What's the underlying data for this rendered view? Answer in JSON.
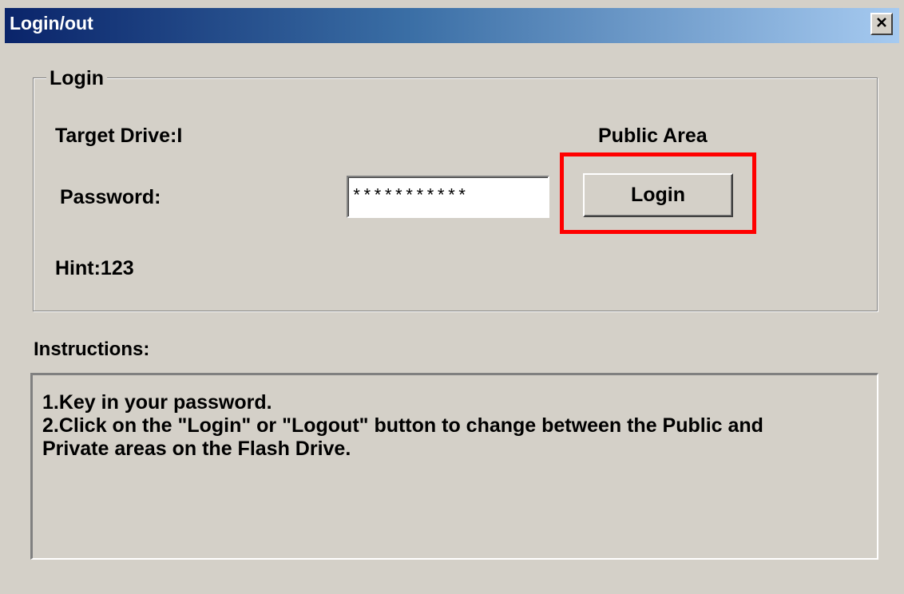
{
  "window": {
    "title": "Login/out",
    "close_icon": "close-icon"
  },
  "login_group": {
    "legend": "Login",
    "target_drive": "Target Drive:I",
    "area": "Public Area",
    "password_label": "Password:",
    "password_value": "***********",
    "login_button": "Login",
    "hint": "Hint:123"
  },
  "instructions": {
    "heading": "Instructions:",
    "lines": [
      "1.Key in your password.",
      "2.Click on the \"Login\" or \"Logout\" button to change between the Public and",
      "Private areas on the Flash Drive."
    ]
  },
  "colors": {
    "highlight": "#ff0000",
    "title_start": "#0a246a",
    "title_end": "#a6caf0"
  }
}
